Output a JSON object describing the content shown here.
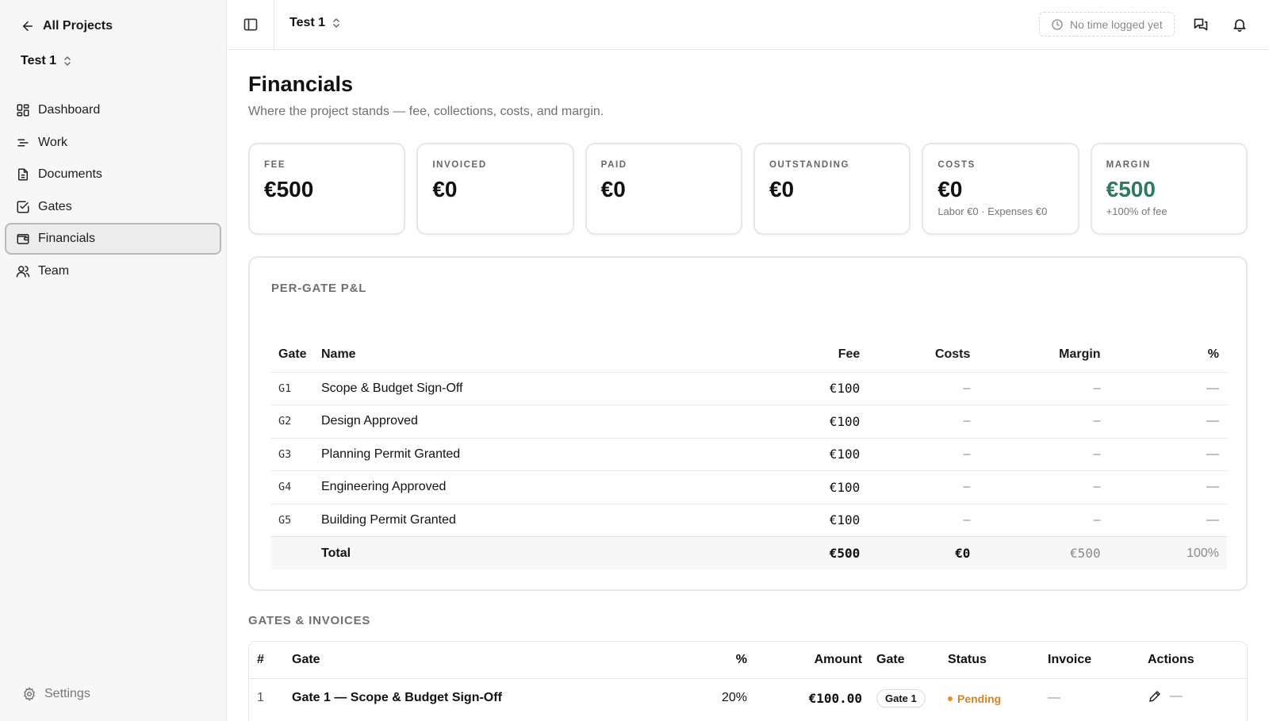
{
  "sidebar": {
    "back_label": "All Projects",
    "project_name": "Test 1",
    "nav": [
      {
        "label": "Dashboard"
      },
      {
        "label": "Work"
      },
      {
        "label": "Documents"
      },
      {
        "label": "Gates"
      },
      {
        "label": "Financials",
        "active": true
      },
      {
        "label": "Team"
      }
    ],
    "settings_label": "Settings"
  },
  "topbar": {
    "project_name": "Test 1",
    "time_status": "No time logged yet"
  },
  "page": {
    "title": "Financials",
    "subtitle": "Where the project stands — fee, collections, costs, and margin."
  },
  "cards": [
    {
      "label": "FEE",
      "value": "€500",
      "note": ""
    },
    {
      "label": "INVOICED",
      "value": "€0",
      "note": ""
    },
    {
      "label": "PAID",
      "value": "€0",
      "note": ""
    },
    {
      "label": "OUTSTANDING",
      "value": "€0",
      "note": ""
    },
    {
      "label": "COSTS",
      "value": "€0",
      "note": "Labor €0 · Expenses €0"
    },
    {
      "label": "MARGIN",
      "value": "€500",
      "note": "+100% of fee",
      "accent": "#2d7a5e"
    }
  ],
  "pl": {
    "heading": "PER-GATE P&L",
    "headers": {
      "gate": "Gate",
      "name": "Name",
      "fee": "Fee",
      "costs": "Costs",
      "margin": "Margin",
      "pct": "%"
    },
    "rows": [
      {
        "gate": "G1",
        "name": "Scope & Budget Sign-Off",
        "fee": "€100",
        "costs": "–",
        "margin": "–",
        "pct": "—"
      },
      {
        "gate": "G2",
        "name": "Design Approved",
        "fee": "€100",
        "costs": "–",
        "margin": "–",
        "pct": "—"
      },
      {
        "gate": "G3",
        "name": "Planning Permit Granted",
        "fee": "€100",
        "costs": "–",
        "margin": "–",
        "pct": "—"
      },
      {
        "gate": "G4",
        "name": "Engineering Approved",
        "fee": "€100",
        "costs": "–",
        "margin": "–",
        "pct": "—"
      },
      {
        "gate": "G5",
        "name": "Building Permit Granted",
        "fee": "€100",
        "costs": "–",
        "margin": "–",
        "pct": "—"
      }
    ],
    "total": {
      "label": "Total",
      "fee": "€500",
      "costs": "€0",
      "margin": "€500",
      "pct": "100%"
    }
  },
  "gates_invoices": {
    "heading": "GATES & INVOICES",
    "headers": {
      "num": "#",
      "gate": "Gate",
      "pct": "%",
      "amount": "Amount",
      "gate_badge": "Gate",
      "status": "Status",
      "invoice": "Invoice",
      "actions": "Actions"
    },
    "rows": [
      {
        "num": "1",
        "gate": "Gate 1 — Scope & Budget Sign-Off",
        "pct": "20%",
        "amount": "€100.00",
        "gate_badge": "Gate 1",
        "status": "Pending",
        "invoice": "—",
        "action_dash": "—"
      }
    ]
  },
  "colors": {
    "accent_green": "#2d7a5e",
    "pending": "#d9831c"
  }
}
